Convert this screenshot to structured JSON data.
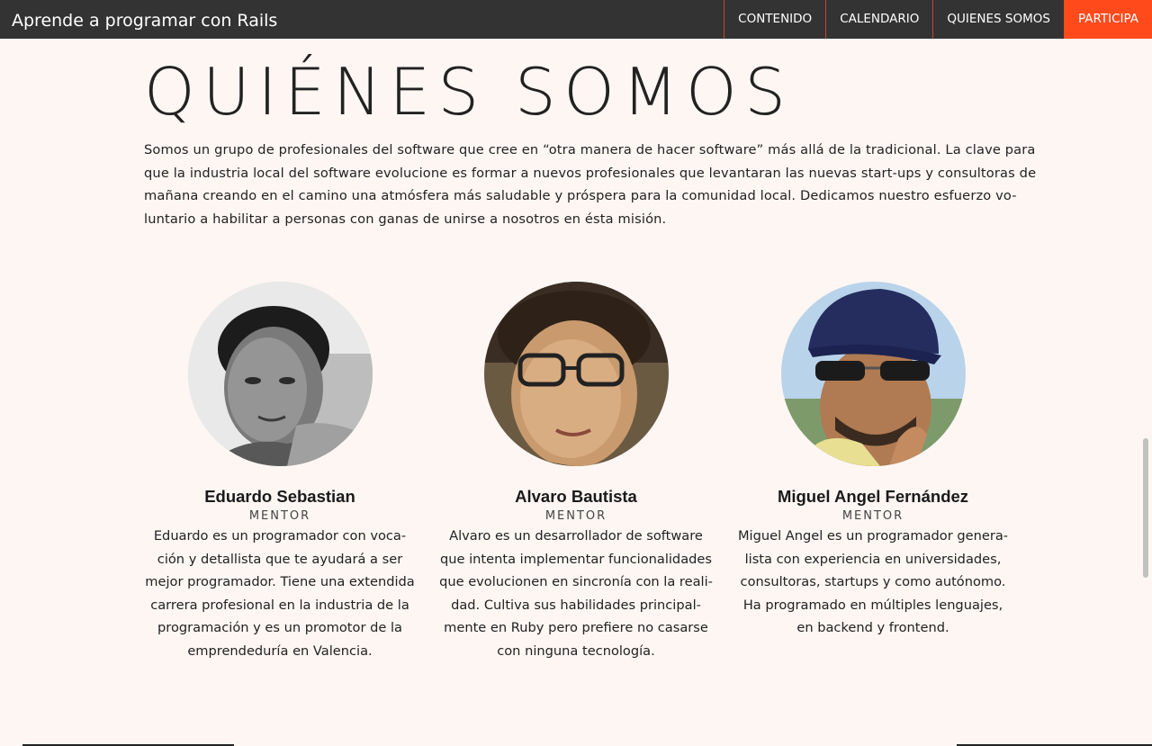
{
  "header": {
    "brand": "Aprende a programar con Rails",
    "nav": [
      {
        "label": "CONTENIDO",
        "active": false
      },
      {
        "label": "CALENDARIO",
        "active": false
      },
      {
        "label": "QUIENES SOMOS",
        "active": false
      },
      {
        "label": "PARTICIPA",
        "active": true
      }
    ],
    "accent_color": "#ff4a1c",
    "bar_color": "#333333"
  },
  "main": {
    "title": "QUIÉNES SOMOS",
    "intro_lines": [
      "Somos un grupo de profesionales del software que cree en “otra manera de hacer software” más allá de la tradicional. La clave para",
      "que la industria local del software evolucione es formar a nuevos profesionales que levantaran las nuevas start-ups y consultoras de",
      "mañana creando en el camino una atmósfera más saludable y próspera para la comunidad local. Dedicamos nuestro esfuerzo vo-",
      "luntario a habilitar a personas con ganas de unirse a nosotros en ésta misión."
    ],
    "members": [
      {
        "name": "Eduardo Sebastian",
        "role": "MENTOR",
        "photo_icon": "portrait-photo",
        "bio_lines": [
          "Eduardo es un programador con voca-",
          "ción y detallista que te ayudará a ser",
          "mejor programador. Tiene una extendida",
          "carrera profesional en la industria de la",
          "programación y es un promotor de la",
          "emprendeduría en Valencia."
        ]
      },
      {
        "name": "Alvaro Bautista",
        "role": "MENTOR",
        "photo_icon": "portrait-photo",
        "bio_lines": [
          "Alvaro es un desarrollador de software",
          "que intenta implementar funcionalidades",
          "que evolucionen en sincronía con la reali-",
          "dad. Cultiva sus habilidades principal-",
          "mente en Ruby pero prefiere no casarse",
          "con ninguna tecnología."
        ]
      },
      {
        "name": "Miguel Angel Fernández",
        "role": "MENTOR",
        "photo_icon": "portrait-photo",
        "bio_lines": [
          "Miguel Angel es un programador genera-",
          "lista con experiencia en universidades,",
          "consultoras, startups y como autónomo.",
          "Ha programado en múltiples lenguajes,",
          "en backend y frontend."
        ]
      }
    ]
  }
}
